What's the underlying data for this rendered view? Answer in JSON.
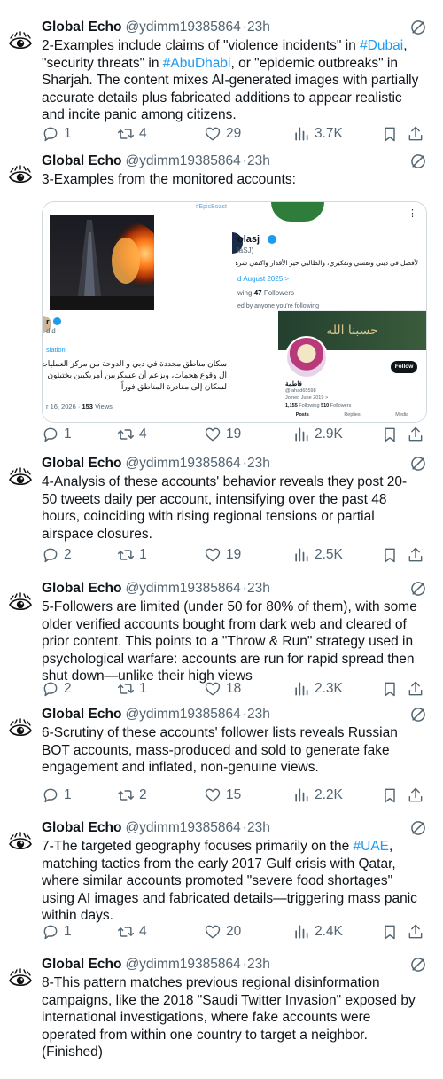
{
  "author": {
    "name": "Global Echo",
    "handle": "@ydimm19385864",
    "time": "23h",
    "sep": "·"
  },
  "colors": {
    "link": "#1d9bf0",
    "muted": "#536471",
    "text": "#0f1419"
  },
  "icons": [
    "eye-avatar-icon",
    "not-interested-icon",
    "reply-icon",
    "retweet-icon",
    "like-icon",
    "views-icon",
    "bookmark-icon",
    "share-icon"
  ],
  "tweets": [
    {
      "segments": [
        {
          "t": "2-Examples include claims of \"violence incidents\" in "
        },
        {
          "t": "#Dubai",
          "hl": true
        },
        {
          "t": ",\n\"security threats\" in "
        },
        {
          "t": "#AbuDhabi",
          "hl": true
        },
        {
          "t": ", or \"epidemic outbreaks\" in\nSharjah. The content mixes AI-generated images with partially\naccurate details plus fabricated additions to appear realistic\nand incite panic among citizens."
        }
      ],
      "replies": "1",
      "retweets": "4",
      "likes": "29",
      "views": "3.7K"
    },
    {
      "segments": [
        {
          "t": "3-Examples from the monitored accounts:"
        }
      ],
      "replies": "1",
      "retweets": "4",
      "likes": "19",
      "views": "2.9K",
      "media": {
        "left": {
          "tag": "#EpicBoast",
          "name": "r",
          "handle": "did",
          "translate_link": "slation",
          "arabic": "سكان مناطق محددة في دبي و الدوحة من مركز العمليات\nال وقوع هجمات، ويزعم أن عسكريين أمريكيين يختبئون\nلسكان إلى مغادرة المناطق فوراً",
          "date": "r 16, 2026 ·",
          "views_count": "153",
          "views_label": "Views"
        },
        "right": {
          "name": "olasj",
          "handle": "laSJ)",
          "bio": "لأفضل في ديني ونفسي وتفكيري، والطالبي خير الأقدار واكتفي شرها.",
          "joined": "d August 2025 >",
          "following_label": "wing",
          "followers_count": "47",
          "followers_label": "Followers",
          "followed_by": "ed by anyone you're following",
          "banner_text": "حسبنا الله",
          "follow_button": "Follow",
          "inner_name": "فاطمة",
          "inner_handle": "@fahad65598",
          "inner_joined": "Joined June 2019 >",
          "inner_following": "1,155",
          "inner_following_label": "Following",
          "inner_followers": "510",
          "inner_followers_label": "Followers",
          "tabs": [
            "Posts",
            "Replies",
            "Media"
          ]
        }
      }
    },
    {
      "segments": [
        {
          "t": "4-Analysis of these accounts' behavior reveals they post 20-\n50 tweets daily per account, intensifying over the past 48\nhours, coinciding with rising regional tensions or partial\nairspace closures."
        }
      ],
      "replies": "2",
      "retweets": "1",
      "likes": "19",
      "views": "2.5K"
    },
    {
      "segments": [
        {
          "t": "5-Followers are limited (under 50 for 80% of them), with some\nolder verified accounts bought from dark web and cleared of\nprior content. This points to a \"Throw & Run\" strategy used in\npsychological warfare: accounts are run for rapid spread then\nshut down—unlike their high views"
        }
      ],
      "replies": "2",
      "retweets": "1",
      "likes": "18",
      "views": "2.3K"
    },
    {
      "segments": [
        {
          "t": "6-Scrutiny of these accounts' follower lists reveals Russian\nBOT accounts, mass-produced and sold  to generate fake\nengagement and inflated, non-genuine views."
        }
      ],
      "replies": "1",
      "retweets": "2",
      "likes": "15",
      "views": "2.2K"
    },
    {
      "segments": [
        {
          "t": "7-The targeted geography focuses primarily on the "
        },
        {
          "t": "#UAE",
          "hl": true
        },
        {
          "t": ",\nmatching tactics from the early 2017 Gulf crisis with Qatar,\nwhere similar accounts promoted \"severe food shortages\"\nusing AI images and fabricated details—triggering mass panic\nwithin days."
        }
      ],
      "replies": "1",
      "retweets": "4",
      "likes": "20",
      "views": "2.4K"
    },
    {
      "segments": [
        {
          "t": "8-This pattern matches previous regional disinformation\ncampaigns, like the 2018 \"Saudi Twitter Invasion\" exposed by\ninternational investigations, where fake accounts were\noperated from within one country to target a neighbor.\n(Finished)"
        }
      ]
    }
  ]
}
